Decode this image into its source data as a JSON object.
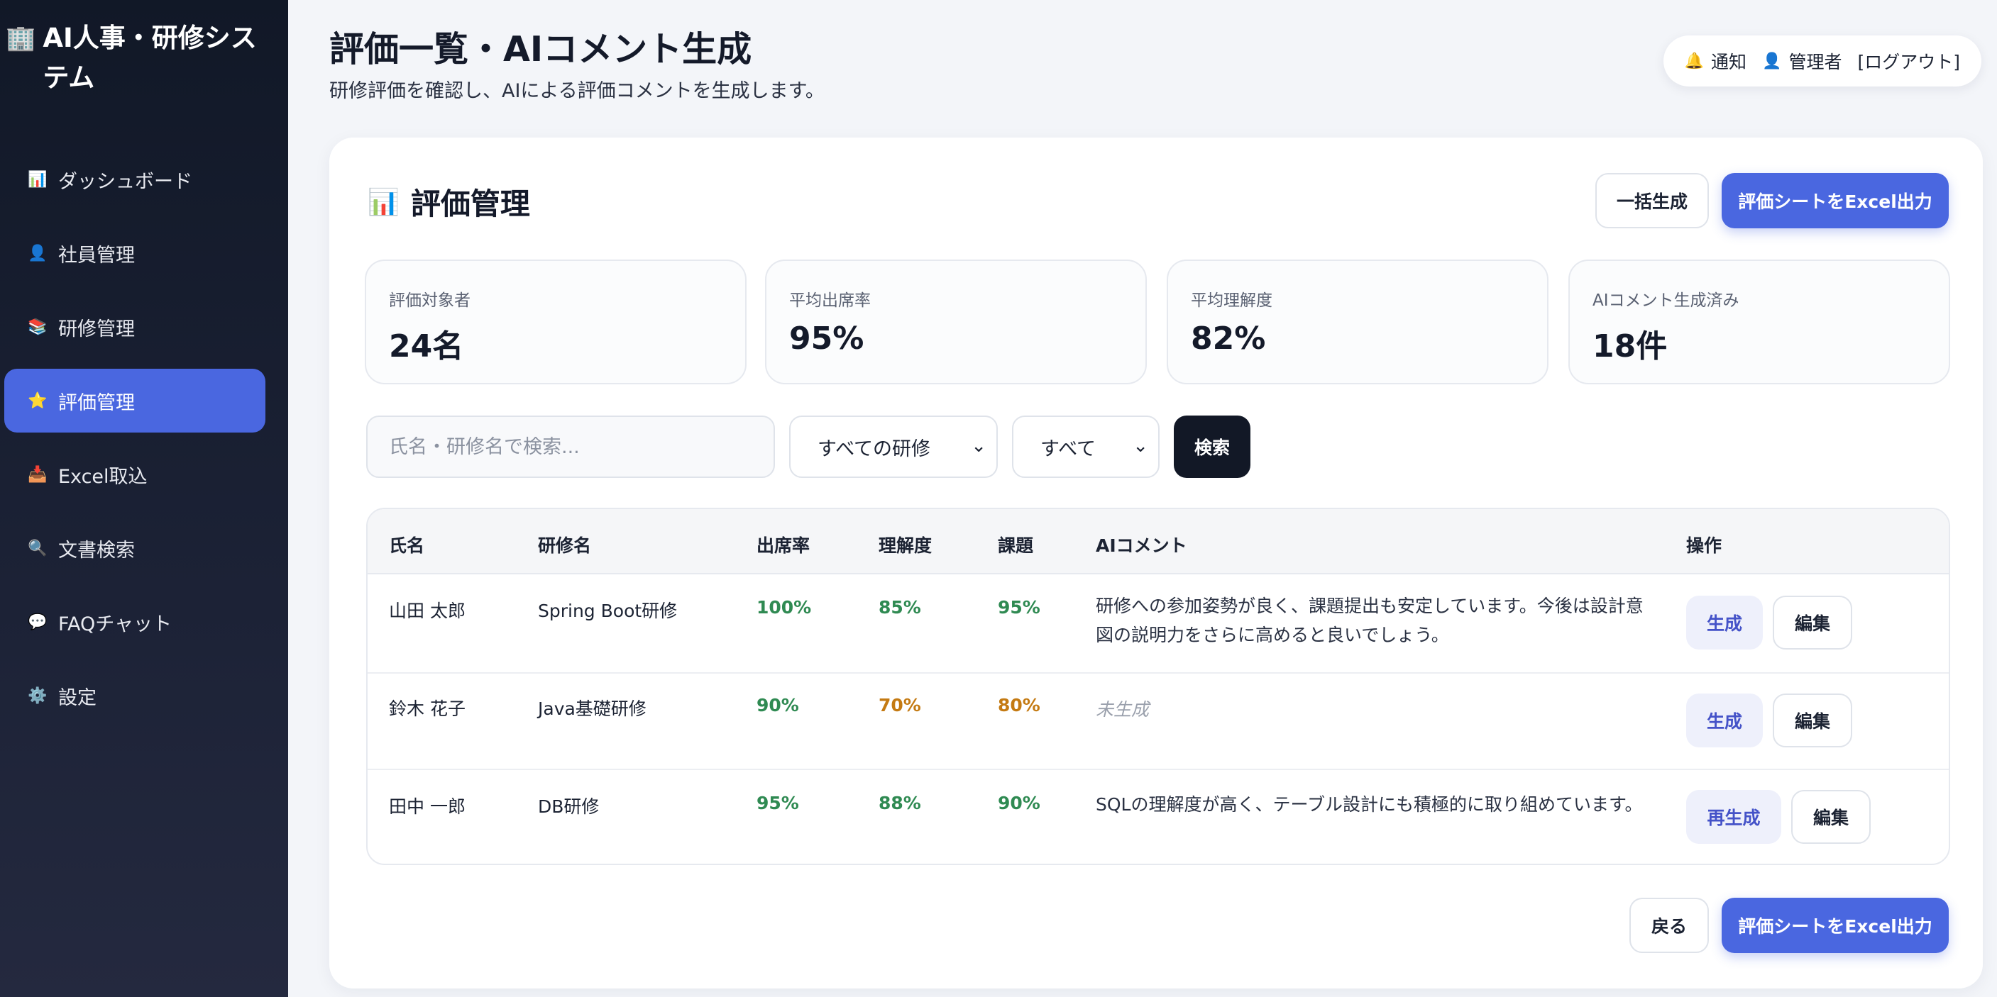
{
  "sidebar": {
    "brand_icon": "🏢",
    "brand_title": "AI人事・研修システム",
    "items": [
      {
        "icon": "📊",
        "icon_name": "chart-icon",
        "label": "ダッシュボード",
        "active": false
      },
      {
        "icon": "👤",
        "icon_name": "user-icon",
        "label": "社員管理",
        "active": false
      },
      {
        "icon": "📚",
        "icon_name": "books-icon",
        "label": "研修管理",
        "active": false
      },
      {
        "icon": "⭐",
        "icon_name": "star-icon",
        "label": "評価管理",
        "active": true
      },
      {
        "icon": "📥",
        "icon_name": "inbox-icon",
        "label": "Excel取込",
        "active": false
      },
      {
        "icon": "🔍",
        "icon_name": "search-icon",
        "label": "文書検索",
        "active": false
      },
      {
        "icon": "💬",
        "icon_name": "chat-icon",
        "label": "FAQチャット",
        "active": false
      },
      {
        "icon": "⚙️",
        "icon_name": "gear-icon",
        "label": "設定",
        "active": false
      }
    ]
  },
  "header": {
    "title": "評価一覧・AIコメント生成",
    "subtitle": "研修評価を確認し、AIによる評価コメントを生成します。",
    "notify_label": "通知",
    "user_label": "管理者",
    "logout_label": "[ログアウト]"
  },
  "card": {
    "title_icon": "📊",
    "title": "評価管理",
    "bulk_label": "一括生成",
    "export_label": "評価シートをExcel出力",
    "back_label": "戻る"
  },
  "stats": [
    {
      "label": "評価対象者",
      "value": "24名"
    },
    {
      "label": "平均出席率",
      "value": "95%"
    },
    {
      "label": "平均理解度",
      "value": "82%"
    },
    {
      "label": "AIコメント生成済み",
      "value": "18件"
    }
  ],
  "filters": {
    "search_placeholder": "氏名・研修名で検索...",
    "training_select": "すべての研修",
    "status_select": "すべて",
    "search_button": "検索"
  },
  "table": {
    "columns": [
      "氏名",
      "研修名",
      "出席率",
      "理解度",
      "課題",
      "AIコメント",
      "操作"
    ],
    "rows": [
      {
        "name": "山田 太郎",
        "training": "Spring Boot研修",
        "attendance": "100%",
        "understanding": "85%",
        "assignment": "95%",
        "comment": "研修への参加姿勢が良く、課題提出も安定しています。今後は設計意図の説明力をさらに高めると良いでしょう。",
        "gen_label": "生成",
        "edit_label": "編集"
      },
      {
        "name": "鈴木 花子",
        "training": "Java基礎研修",
        "attendance": "90%",
        "understanding": "70%",
        "assignment": "80%",
        "comment": "未生成",
        "gen_label": "生成",
        "edit_label": "編集"
      },
      {
        "name": "田中 一郎",
        "training": "DB研修",
        "attendance": "95%",
        "understanding": "88%",
        "assignment": "90%",
        "comment": "SQLの理解度が高く、テーブル設計にも積極的に取り組めています。",
        "gen_label": "再生成",
        "edit_label": "編集"
      }
    ]
  },
  "colors": {
    "accent": "#4a67e0",
    "sidebar_bg": "#111827",
    "good": "#2f8a52",
    "warning": "#c47a12"
  }
}
